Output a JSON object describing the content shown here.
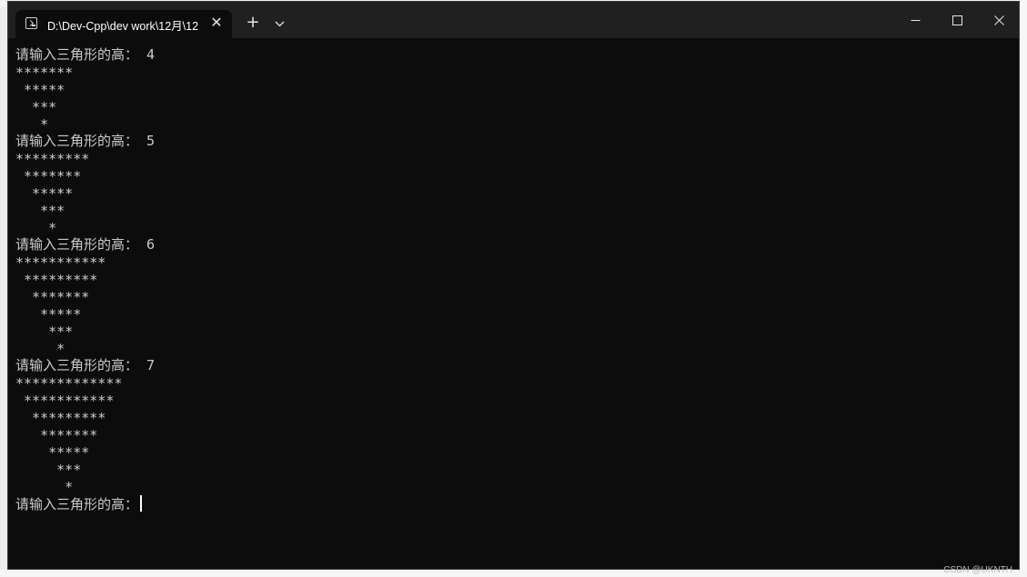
{
  "window": {
    "tab_title": "D:\\Dev-Cpp\\dev work\\12月\\12",
    "close_tab_symbol": "✕",
    "new_tab_symbol": "+"
  },
  "console": {
    "lines": [
      "请输入三角形的高： 4",
      "*******",
      " *****",
      "  ***",
      "   *",
      "请输入三角形的高： 5",
      "*********",
      " *******",
      "  *****",
      "   ***",
      "    *",
      "请输入三角形的高： 6",
      "***********",
      " *********",
      "  *******",
      "   *****",
      "    ***",
      "     *",
      "请输入三角形的高： 7",
      "*************",
      " ***********",
      "  *********",
      "   *******",
      "    *****",
      "     ***",
      "      *",
      "请输入三角形的高："
    ]
  },
  "watermark": "CSDN @UKNTH",
  "colors": {
    "console_bg": "#0c0c0c",
    "console_text": "#cccccc",
    "titlebar_bg": "#202020"
  }
}
